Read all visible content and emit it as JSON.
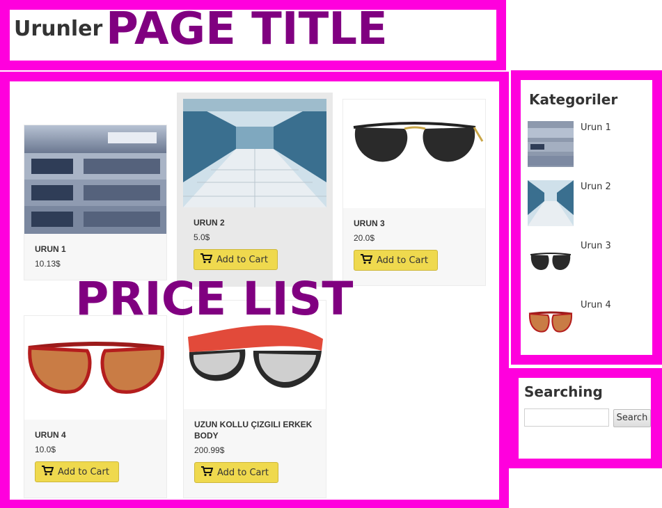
{
  "header": {
    "breadcrumb_title": "Urunler",
    "overlay_label": "PAGE TITLE"
  },
  "price_overlay_label": "PRICE LIST",
  "products": [
    {
      "name": "URUN 1",
      "price": "10.13$",
      "image_icon": "server-rack-icon",
      "has_cart_button": false
    },
    {
      "name": "URUN 2",
      "price": "5.0$",
      "image_icon": "data-center-icon",
      "has_cart_button": true,
      "cart_label": "Add to Cart"
    },
    {
      "name": "URUN 3",
      "price": "20.0$",
      "image_icon": "sunglasses-black-icon",
      "has_cart_button": true,
      "cart_label": "Add to Cart"
    },
    {
      "name": "URUN 4",
      "price": "10.0$",
      "image_icon": "sunglasses-red-cateye-icon",
      "has_cart_button": true,
      "cart_label": "Add to Cart"
    },
    {
      "name": "UZUN KOLLU ÇIZGILI ERKEK BODY",
      "price": "200.99$",
      "image_icon": "sunglasses-red-wayfarer-icon",
      "has_cart_button": true,
      "cart_label": "Add to Cart"
    }
  ],
  "categories": {
    "title": "Kategoriler",
    "items": [
      {
        "label": "Urun 1",
        "icon": "server-rack-icon"
      },
      {
        "label": "Urun 2",
        "icon": "data-center-icon"
      },
      {
        "label": "Urun 3",
        "icon": "sunglasses-black-icon"
      },
      {
        "label": "Urun 4",
        "icon": "sunglasses-red-cateye-icon"
      }
    ]
  },
  "search": {
    "title": "Searching",
    "button_label": "Search",
    "input_value": ""
  },
  "colors": {
    "frame": "#ff00dd",
    "overlay_text": "#800080",
    "cart_button": "#efd94e"
  }
}
